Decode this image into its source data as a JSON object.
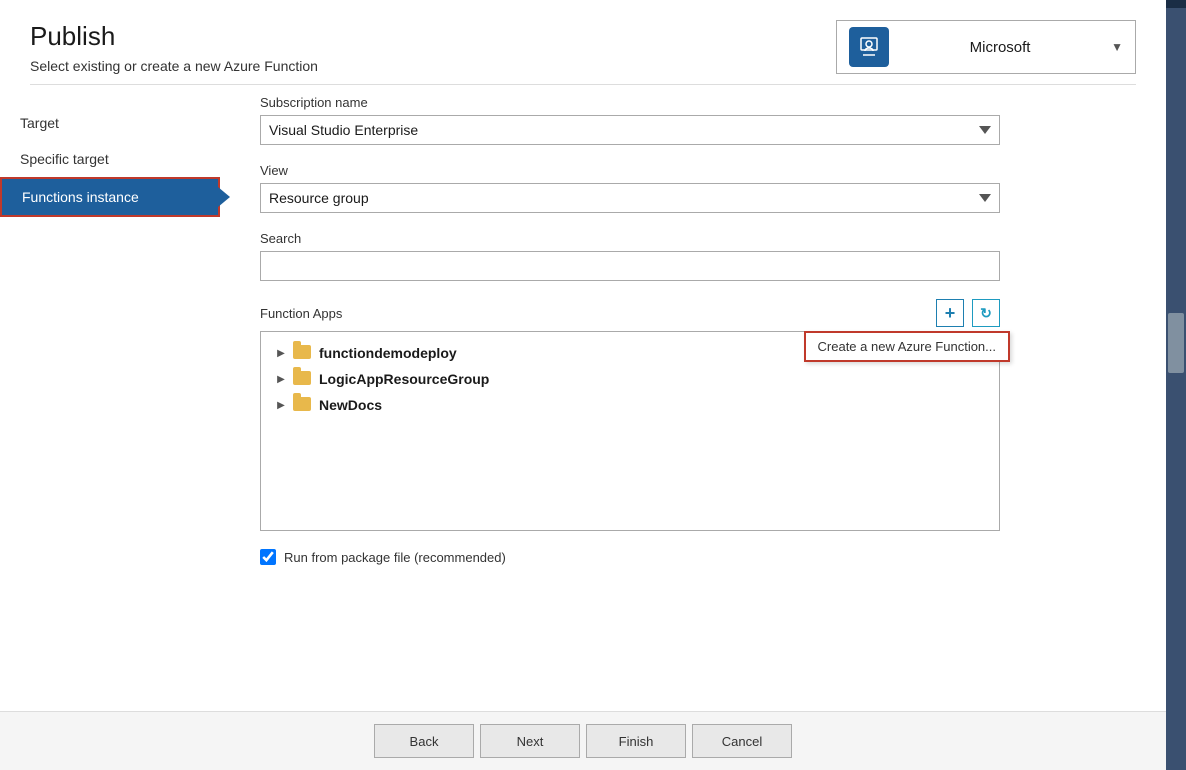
{
  "header": {
    "title": "Publish",
    "subtitle": "Select existing or create a new Azure Function",
    "account": {
      "name": "Microsoft",
      "icon_label": "person-icon"
    }
  },
  "nav": {
    "items": [
      {
        "id": "target",
        "label": "Target"
      },
      {
        "id": "specific-target",
        "label": "Specific target"
      },
      {
        "id": "functions-instance",
        "label": "Functions instance",
        "active": true
      }
    ]
  },
  "form": {
    "subscription_label": "Subscription name",
    "subscription_value": "Visual Studio Enterprise",
    "view_label": "View",
    "view_value": "Resource group",
    "search_label": "Search",
    "search_placeholder": "",
    "function_apps_label": "Function Apps",
    "create_tooltip": "Create a new Azure Function...",
    "tree_items": [
      {
        "id": "functiondemodeploy",
        "label": "functiondemodeploy"
      },
      {
        "id": "LogicAppResourceGroup",
        "label": "LogicAppResourceGroup"
      },
      {
        "id": "NewDocs",
        "label": "NewDocs"
      }
    ],
    "checkbox_label": "Run from package file (recommended)",
    "checkbox_checked": true
  },
  "footer": {
    "back_label": "Back",
    "next_label": "Next",
    "finish_label": "Finish",
    "cancel_label": "Cancel"
  },
  "icons": {
    "add": "+",
    "refresh": "↻",
    "dropdown_arrow": "▼",
    "expand": "▶",
    "person": "👤"
  }
}
